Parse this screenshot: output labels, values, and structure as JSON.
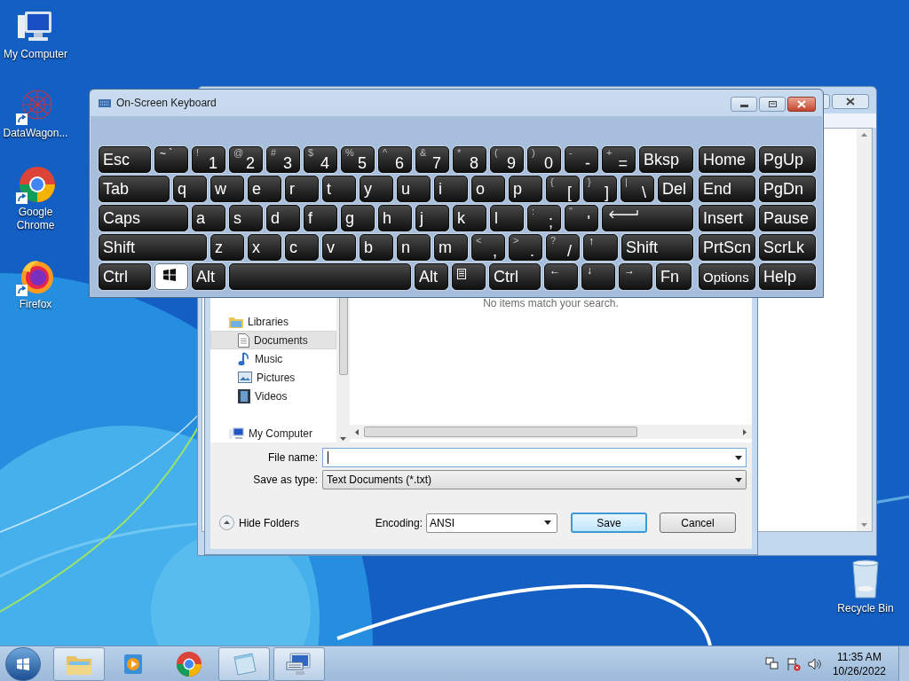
{
  "desktop_icons": [
    {
      "label": "My Computer",
      "kind": "computer",
      "shortcut": false
    },
    {
      "label": "DataWagon...",
      "kind": "datawagon",
      "shortcut": true
    },
    {
      "label": "Google Chrome",
      "kind": "chrome",
      "shortcut": true
    },
    {
      "label": "Firefox",
      "kind": "firefox",
      "shortcut": true
    }
  ],
  "recycle_bin": {
    "label": "Recycle Bin"
  },
  "save_dialog": {
    "nav_items": [
      {
        "label": "Libraries",
        "kind": "libraries",
        "selected": false
      },
      {
        "label": "Documents",
        "kind": "documents",
        "selected": true
      },
      {
        "label": "Music",
        "kind": "music",
        "selected": false
      },
      {
        "label": "Pictures",
        "kind": "pictures",
        "selected": false
      },
      {
        "label": "Videos",
        "kind": "videos",
        "selected": false
      },
      {
        "label": "My Computer",
        "kind": "computer",
        "selected": false
      }
    ],
    "empty_message": "No items match your search.",
    "file_name": {
      "label": "File name:"
    },
    "save_as_type": {
      "label": "Save as type:",
      "value": "Text Documents (*.txt)"
    },
    "hide_folders": "Hide Folders",
    "encoding": {
      "label": "Encoding:",
      "value": "ANSI"
    },
    "buttons": [
      {
        "label": "Save",
        "default": true
      },
      {
        "label": "Cancel",
        "default": false
      }
    ]
  },
  "keyboard": {
    "title": "On-Screen Keyboard",
    "rows": [
      {
        "keys": [
          {
            "kind": "text",
            "label": "Esc",
            "pressed": false
          },
          {
            "kind": "small",
            "label": "~ `",
            "pressed": false
          },
          {
            "kind": "dual",
            "shift": "!",
            "label": "1",
            "pressed": false
          },
          {
            "kind": "dual",
            "shift": "@",
            "label": "2",
            "pressed": false
          },
          {
            "kind": "dual",
            "shift": "#",
            "label": "3",
            "pressed": false
          },
          {
            "kind": "dual",
            "shift": "$",
            "label": "4",
            "pressed": false
          },
          {
            "kind": "dual",
            "shift": "%",
            "label": "5",
            "pressed": false
          },
          {
            "kind": "dual",
            "shift": "^",
            "label": "6",
            "pressed": false
          },
          {
            "kind": "dual",
            "shift": "&",
            "label": "7",
            "pressed": false
          },
          {
            "kind": "dual",
            "shift": "*",
            "label": "8",
            "pressed": false
          },
          {
            "kind": "dual",
            "shift": "(",
            "label": "9",
            "pressed": false
          },
          {
            "kind": "dual",
            "shift": ")",
            "label": "0",
            "pressed": false
          },
          {
            "kind": "dual",
            "shift": "-",
            "label": "-",
            "pressed": false
          },
          {
            "kind": "dual",
            "shift": "+",
            "label": "=",
            "pressed": false
          },
          {
            "kind": "text",
            "label": "Bksp",
            "pressed": false
          }
        ]
      },
      {
        "keys": [
          {
            "kind": "text",
            "label": "Tab",
            "pressed": false
          },
          {
            "kind": "text",
            "label": "q",
            "pressed": false
          },
          {
            "kind": "text",
            "label": "w",
            "pressed": false
          },
          {
            "kind": "text",
            "label": "e",
            "pressed": false
          },
          {
            "kind": "text",
            "label": "r",
            "pressed": false
          },
          {
            "kind": "text",
            "label": "t",
            "pressed": false
          },
          {
            "kind": "text",
            "label": "y",
            "pressed": false
          },
          {
            "kind": "text",
            "label": "u",
            "pressed": false
          },
          {
            "kind": "text",
            "label": "i",
            "pressed": false
          },
          {
            "kind": "text",
            "label": "o",
            "pressed": false
          },
          {
            "kind": "text",
            "label": "p",
            "pressed": false
          },
          {
            "kind": "dual",
            "shift": "{",
            "label": "[",
            "pressed": false
          },
          {
            "kind": "dual",
            "shift": "}",
            "label": "]",
            "pressed": false
          },
          {
            "kind": "dual",
            "shift": "|",
            "label": "\\",
            "pressed": false
          },
          {
            "kind": "text",
            "label": "Del",
            "pressed": false
          }
        ]
      },
      {
        "keys": [
          {
            "kind": "text",
            "label": "Caps",
            "pressed": false
          },
          {
            "kind": "text",
            "label": "a",
            "pressed": false
          },
          {
            "kind": "text",
            "label": "s",
            "pressed": false
          },
          {
            "kind": "text",
            "label": "d",
            "pressed": false
          },
          {
            "kind": "text",
            "label": "f",
            "pressed": false
          },
          {
            "kind": "text",
            "label": "g",
            "pressed": false
          },
          {
            "kind": "text",
            "label": "h",
            "pressed": false
          },
          {
            "kind": "text",
            "label": "j",
            "pressed": false
          },
          {
            "kind": "text",
            "label": "k",
            "pressed": false
          },
          {
            "kind": "text",
            "label": "l",
            "pressed": false
          },
          {
            "kind": "dual",
            "shift": ":",
            "label": ";",
            "pressed": false
          },
          {
            "kind": "dual",
            "shift": "\"",
            "label": "'",
            "pressed": false
          },
          {
            "kind": "enter",
            "pressed": false
          }
        ]
      },
      {
        "keys": [
          {
            "kind": "text",
            "label": "Shift",
            "pressed": false
          },
          {
            "kind": "text",
            "label": "z",
            "pressed": false
          },
          {
            "kind": "text",
            "label": "x",
            "pressed": false
          },
          {
            "kind": "text",
            "label": "c",
            "pressed": false
          },
          {
            "kind": "text",
            "label": "v",
            "pressed": false
          },
          {
            "kind": "text",
            "label": "b",
            "pressed": false
          },
          {
            "kind": "text",
            "label": "n",
            "pressed": false
          },
          {
            "kind": "text",
            "label": "m",
            "pressed": false
          },
          {
            "kind": "dual",
            "shift": "<",
            "label": ",",
            "pressed": false
          },
          {
            "kind": "dual",
            "shift": ">",
            "label": ".",
            "pressed": false
          },
          {
            "kind": "dual",
            "shift": "?",
            "label": "/",
            "pressed": false
          },
          {
            "kind": "small",
            "label": "↑",
            "pressed": false
          },
          {
            "kind": "text",
            "label": "Shift",
            "pressed": false
          }
        ]
      },
      {
        "keys": [
          {
            "kind": "text",
            "label": "Ctrl",
            "pressed": false
          },
          {
            "kind": "windows",
            "pressed": true
          },
          {
            "kind": "text",
            "label": "Alt",
            "pressed": false
          },
          {
            "kind": "space",
            "pressed": false
          },
          {
            "kind": "text",
            "label": "Alt",
            "pressed": false
          },
          {
            "kind": "menu",
            "pressed": false
          },
          {
            "kind": "text",
            "label": "Ctrl",
            "pressed": false
          },
          {
            "kind": "small",
            "label": "←",
            "pressed": false
          },
          {
            "kind": "small",
            "label": "↓",
            "pressed": false
          },
          {
            "kind": "small",
            "label": "→",
            "pressed": false
          },
          {
            "kind": "text",
            "label": "Fn",
            "pressed": false
          }
        ]
      }
    ],
    "nav_rows": [
      {
        "keys": [
          {
            "kind": "text",
            "label": "Home",
            "pressed": false
          },
          {
            "kind": "text",
            "label": "PgUp",
            "pressed": false
          }
        ]
      },
      {
        "keys": [
          {
            "kind": "text",
            "label": "End",
            "pressed": false
          },
          {
            "kind": "text",
            "label": "PgDn",
            "pressed": false
          }
        ]
      },
      {
        "keys": [
          {
            "kind": "text",
            "label": "Insert",
            "pressed": false
          },
          {
            "kind": "text",
            "label": "Pause",
            "pressed": false
          }
        ]
      },
      {
        "keys": [
          {
            "kind": "text",
            "label": "PrtScn",
            "pressed": false
          },
          {
            "kind": "text",
            "label": "ScrLk",
            "pressed": false
          }
        ]
      },
      {
        "keys": [
          {
            "kind": "option",
            "label": "Options",
            "pressed": false
          },
          {
            "kind": "text",
            "label": "Help",
            "pressed": false
          }
        ]
      }
    ]
  },
  "taskbar": {
    "items": [
      {
        "kind": "explorer",
        "open": true
      },
      {
        "kind": "media",
        "open": false
      },
      {
        "kind": "chrome",
        "open": false
      },
      {
        "kind": "notepad",
        "open": true
      },
      {
        "kind": "keyboard",
        "open": true
      }
    ],
    "clock": {
      "time": "11:35 AM",
      "date": "10/26/2022"
    }
  }
}
